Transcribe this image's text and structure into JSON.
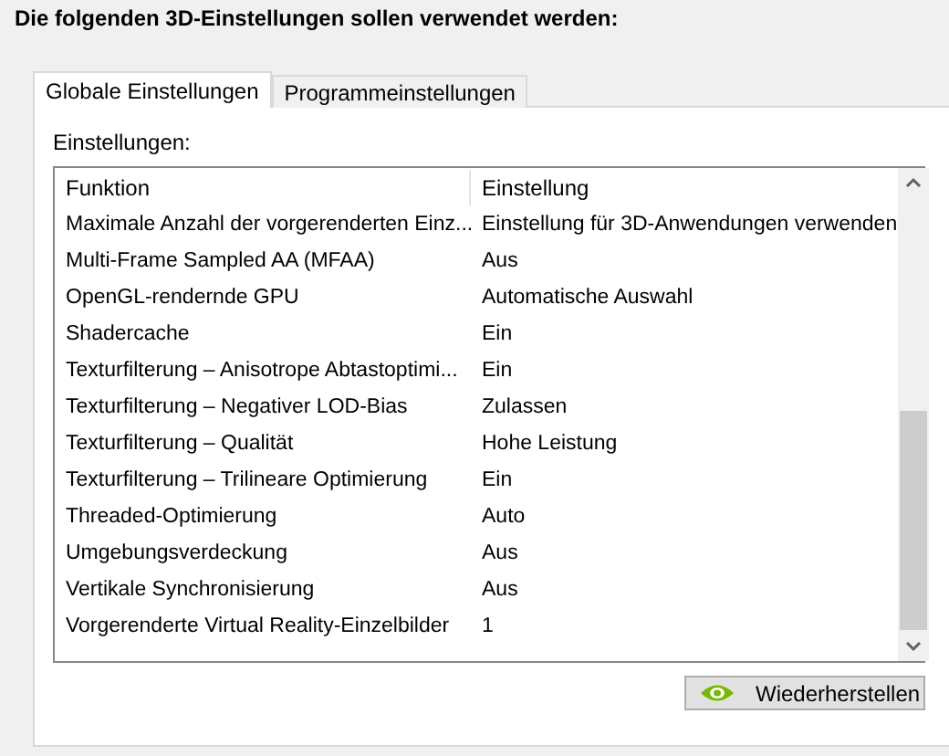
{
  "heading": "Die folgenden 3D-Einstellungen sollen verwendet werden:",
  "tabs": [
    {
      "label": "Globale Einstellungen",
      "selected": true
    },
    {
      "label": "Programmeinstellungen",
      "selected": false
    }
  ],
  "settings_label": "Einstellungen:",
  "table": {
    "columns": [
      "Funktion",
      "Einstellung"
    ],
    "rows": [
      [
        "Maximale Anzahl der vorgerenderten Einz...",
        "Einstellung für 3D-Anwendungen verwenden"
      ],
      [
        "Multi-Frame Sampled AA (MFAA)",
        "Aus"
      ],
      [
        "OpenGL-rendernde GPU",
        "Automatische Auswahl"
      ],
      [
        "Shadercache",
        "Ein"
      ],
      [
        "Texturfilterung – Anisotrope Abtastoptimi...",
        "Ein"
      ],
      [
        "Texturfilterung – Negativer LOD-Bias",
        "Zulassen"
      ],
      [
        "Texturfilterung – Qualität",
        "Hohe Leistung"
      ],
      [
        "Texturfilterung – Trilineare Optimierung",
        "Ein"
      ],
      [
        "Threaded-Optimierung",
        "Auto"
      ],
      [
        "Umgebungsverdeckung",
        "Aus"
      ],
      [
        "Vertikale Synchronisierung",
        "Aus"
      ],
      [
        "Vorgerenderte Virtual Reality-Einzelbilder",
        "1"
      ]
    ]
  },
  "restore_button": "Wiederherstellen"
}
